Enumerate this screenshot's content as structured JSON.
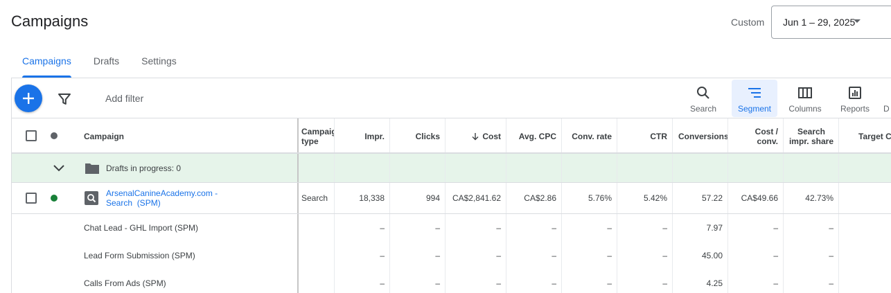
{
  "header": {
    "title": "Campaigns",
    "custom_label": "Custom",
    "date_range": "Jun 1 – 29, 2025"
  },
  "tabs": [
    {
      "label": "Campaigns",
      "active": true
    },
    {
      "label": "Drafts",
      "active": false
    },
    {
      "label": "Settings",
      "active": false
    }
  ],
  "toolbar": {
    "add_filter": "Add filter",
    "tools": [
      {
        "label": "Search",
        "icon": "search-icon"
      },
      {
        "label": "Segment",
        "icon": "segment-icon",
        "active": true
      },
      {
        "label": "Columns",
        "icon": "columns-icon"
      },
      {
        "label": "Reports",
        "icon": "reports-icon"
      },
      {
        "label": "D",
        "icon": "download-icon"
      }
    ]
  },
  "columns": {
    "campaign": "Campaign",
    "campaign_type": [
      "Campaign",
      "type"
    ],
    "impr": "Impr.",
    "clicks": "Clicks",
    "cost": "Cost",
    "avg_cpc": "Avg. CPC",
    "conv_rate": "Conv. rate",
    "ctr": "CTR",
    "conversions": "Conversions",
    "cost_conv": [
      "Cost /",
      "conv."
    ],
    "search_impr_share": [
      "Search",
      "impr. share"
    ],
    "target_cpa": "Target CPA"
  },
  "drafts": {
    "label": "Drafts in progress: 0"
  },
  "campaign": {
    "name_line1": "ArsenalCanineAcademy.com -",
    "name_line2": "Search  (SPM)",
    "type": "Search",
    "impr": "18,338",
    "clicks": "994",
    "cost": "CA$2,841.62",
    "avg_cpc": "CA$2.86",
    "conv_rate": "5.76%",
    "ctr": "5.42%",
    "conversions": "57.22",
    "cost_conv": "CA$49.66",
    "search_impr_share": "42.73%",
    "status_color": "#188038"
  },
  "conversion_actions": [
    {
      "name": "Chat Lead - GHL Import (SPM)",
      "conversions": "7.97",
      "dash": "–"
    },
    {
      "name": "Lead Form Submission (SPM)",
      "conversions": "45.00",
      "dash": "–"
    },
    {
      "name": "Calls From Ads (SPM)",
      "conversions": "4.25",
      "dash": "–"
    }
  ],
  "colors": {
    "accent": "#1a73e8",
    "drafts_bg": "#e6f4ea",
    "enabled_dot": "#188038"
  }
}
